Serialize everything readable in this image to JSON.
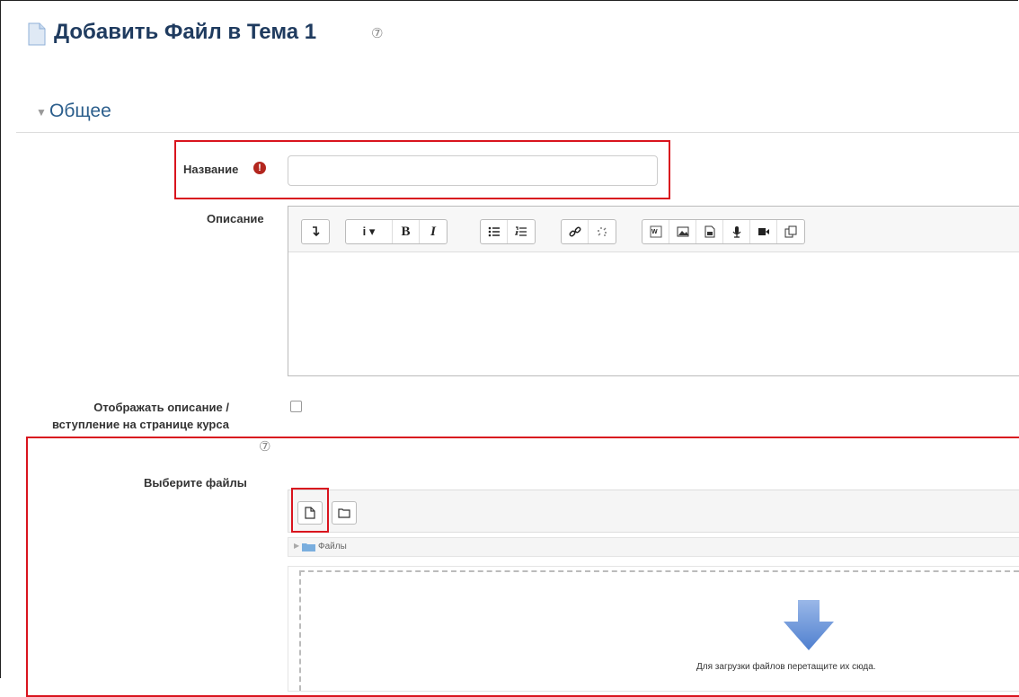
{
  "header": {
    "title": "Добавить Файл в Тема 1",
    "help_icon": "question-circle-icon",
    "doc_icon": "file-icon"
  },
  "section": {
    "toggle_icon": "caret-down-icon",
    "title": "Общее"
  },
  "fields": {
    "name": {
      "label": "Название",
      "value": "",
      "required_icon": "exclamation-circle-icon"
    },
    "description": {
      "label": "Описание",
      "toolbar": [
        [
          "arrow-down-icon"
        ],
        [
          "info-dropdown-icon",
          "bold-icon",
          "italic-icon"
        ],
        [
          "bullet-list-icon",
          "numbered-list-icon"
        ],
        [
          "link-icon",
          "unlink-icon"
        ],
        [
          "word-paste-icon",
          "image-icon",
          "media-icon",
          "microphone-icon",
          "video-icon",
          "copy-icon"
        ]
      ],
      "glyphs": {
        "bold": "B",
        "italic": "I",
        "info": "i ▾"
      }
    },
    "show_description": {
      "label_line1": "Отображать описание /",
      "label_line2": "вступление на странице курса",
      "checked": false
    },
    "files": {
      "label": "Выберите файлы",
      "buttons": [
        "add-file-icon",
        "create-folder-icon"
      ],
      "path_label": "Файлы",
      "drop_text": "Для загрузки файлов перетащите их сюда."
    }
  },
  "colors": {
    "title": "#1f3b5f",
    "section": "#2b5e8c",
    "highlight": "#d9141e",
    "required": "#b3261e"
  }
}
